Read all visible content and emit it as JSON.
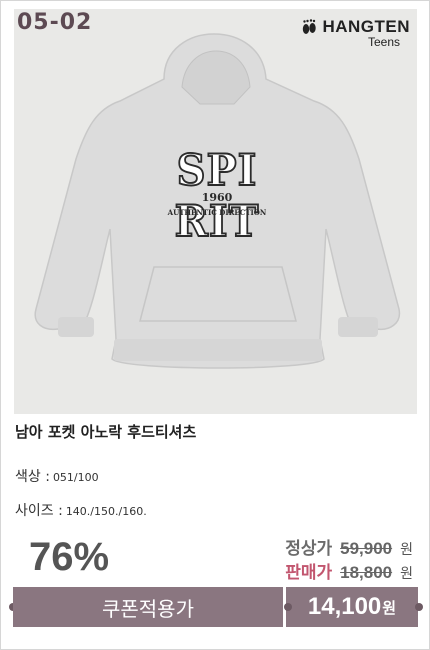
{
  "product": {
    "code": "05-02",
    "brand_name": "HANGTEN",
    "brand_sub": "Teens",
    "image_print_main": "SPI RIT",
    "image_print_year": "1960",
    "image_print_sub": "AUTHENTIC DIRECTION",
    "title": "남아 포켓 아노락 후드티셔츠",
    "color_label": "색상 :",
    "color_value": "051/100",
    "size_label": "사이즈 :",
    "size_value": "140./150./160."
  },
  "pricing": {
    "discount": "76%",
    "regular_label": "정상가",
    "regular_price": "59,900",
    "sale_label": "판매가",
    "sale_price": "18,800",
    "currency": "원"
  },
  "bottom_bar": {
    "coupon_label": "쿠폰적용가",
    "final_price": "14,100",
    "final_unit": "원"
  },
  "colors": {
    "accent": "#8a7680",
    "code_text": "#5d4a53",
    "regular_label": "#6b6b6b",
    "sale_label": "#c2566f"
  }
}
